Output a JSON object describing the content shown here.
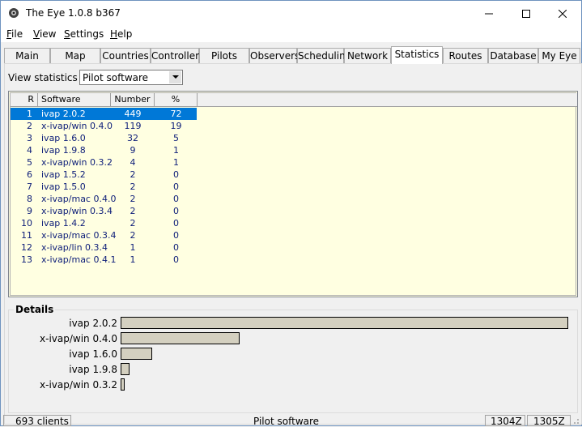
{
  "window": {
    "title": "The Eye 1.0.8 b367",
    "controls": [
      "minimize",
      "maximize",
      "close"
    ]
  },
  "menu": [
    {
      "label": "File",
      "accel": "F",
      "rest": "ile"
    },
    {
      "label": "View",
      "accel": "V",
      "rest": "iew"
    },
    {
      "label": "Settings",
      "accel": "S",
      "rest": "ettings"
    },
    {
      "label": "Help",
      "accel": "H",
      "rest": "elp"
    }
  ],
  "tabs": [
    "Main",
    "Map",
    "Countries",
    "Controllers",
    "Pilots",
    "Observers",
    "Scheduling",
    "Network",
    "Statistics",
    "Routes",
    "Database",
    "My Eye"
  ],
  "active_tab": "Statistics",
  "stats": {
    "label": "View statistics on:",
    "selected": "Pilot software"
  },
  "table": {
    "columns": [
      "R",
      "Software",
      "Number",
      "%"
    ],
    "rows": [
      {
        "r": "1",
        "software": "ivap 2.0.2",
        "number": "449",
        "pct": "72"
      },
      {
        "r": "2",
        "software": "x-ivap/win 0.4.0",
        "number": "119",
        "pct": "19"
      },
      {
        "r": "3",
        "software": "ivap 1.6.0",
        "number": "32",
        "pct": "5"
      },
      {
        "r": "4",
        "software": "ivap 1.9.8",
        "number": "9",
        "pct": "1"
      },
      {
        "r": "5",
        "software": "x-ivap/win 0.3.2",
        "number": "4",
        "pct": "1"
      },
      {
        "r": "6",
        "software": "ivap 1.5.2",
        "number": "2",
        "pct": "0"
      },
      {
        "r": "7",
        "software": "ivap 1.5.0",
        "number": "2",
        "pct": "0"
      },
      {
        "r": "8",
        "software": "x-ivap/mac 0.4.0",
        "number": "2",
        "pct": "0"
      },
      {
        "r": "9",
        "software": "x-ivap/win 0.3.4",
        "number": "2",
        "pct": "0"
      },
      {
        "r": "10",
        "software": "ivap 1.4.2",
        "number": "2",
        "pct": "0"
      },
      {
        "r": "11",
        "software": "x-ivap/mac 0.3.4",
        "number": "2",
        "pct": "0"
      },
      {
        "r": "12",
        "software": "x-ivap/lin 0.3.4",
        "number": "1",
        "pct": "0"
      },
      {
        "r": "13",
        "software": "x-ivap/mac 0.4.1",
        "number": "1",
        "pct": "0"
      }
    ],
    "selected_row": 0
  },
  "details": {
    "title": "Details",
    "bars": [
      {
        "label": "ivap 2.0.2",
        "value": 449
      },
      {
        "label": "x-ivap/win 0.4.0",
        "value": 119
      },
      {
        "label": "ivap 1.6.0",
        "value": 32
      },
      {
        "label": "ivap 1.9.8",
        "value": 9
      },
      {
        "label": "x-ivap/win 0.3.2",
        "value": 4
      }
    ],
    "max_value": 449
  },
  "status": {
    "clients": "693 clients",
    "center": "Pilot software",
    "time1": "1304Z",
    "time2": "1305Z"
  }
}
